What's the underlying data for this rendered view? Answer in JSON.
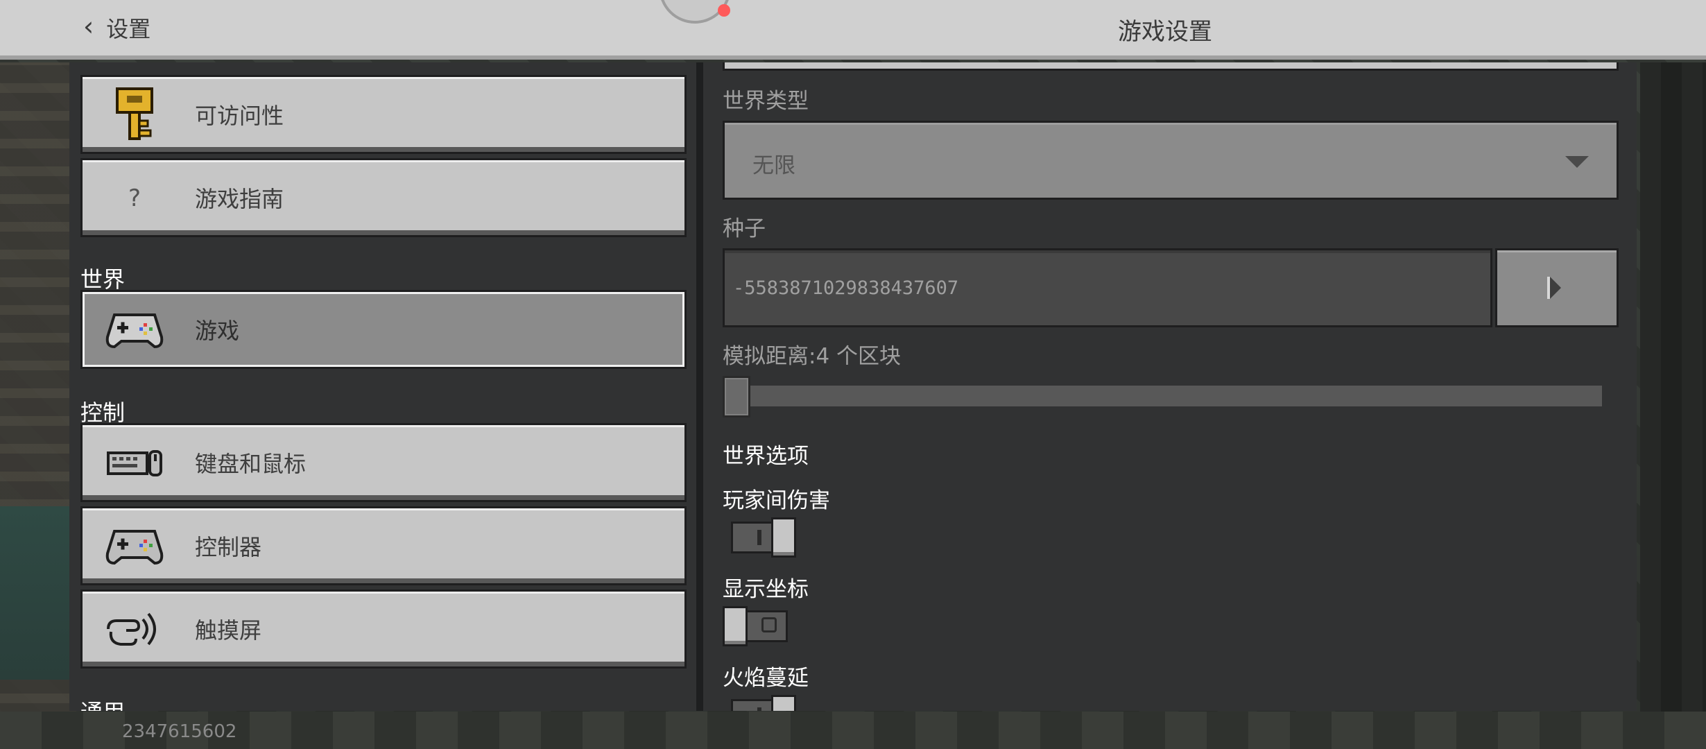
{
  "header": {
    "back_label": "设置",
    "title": "游戏设置"
  },
  "sidebar": {
    "items": [
      {
        "label": "可访问性",
        "icon": "key-icon"
      },
      {
        "label": "游戏指南",
        "icon": "question-icon"
      },
      {
        "label": "游戏",
        "icon": "controller-icon",
        "selected": true
      },
      {
        "label": "键盘和鼠标",
        "icon": "keyboard-mouse-icon"
      },
      {
        "label": "控制器",
        "icon": "controller-icon"
      },
      {
        "label": "触摸屏",
        "icon": "touch-icon"
      }
    ],
    "sections": {
      "world": "世界",
      "controls": "控制",
      "general": "通用"
    }
  },
  "main": {
    "world_type": {
      "label": "世界类型",
      "value": "无限"
    },
    "seed": {
      "label": "种子",
      "value": "-5583871029838437607"
    },
    "simulation_distance": {
      "label": "模拟距离:4 个区块",
      "value_chunks": 4
    },
    "world_options_title": "世界选项",
    "toggles": [
      {
        "label": "玩家间伤害",
        "on": true
      },
      {
        "label": "显示坐标",
        "on": false
      },
      {
        "label": "火焰蔓延",
        "on": true
      }
    ]
  },
  "footer": {
    "build_id": "2347615602"
  },
  "colors": {
    "button_face": "#c6c6c6",
    "button_selected": "#8b8b8b",
    "panel_bg": "#313233",
    "header_bg": "#d0d0d0"
  }
}
